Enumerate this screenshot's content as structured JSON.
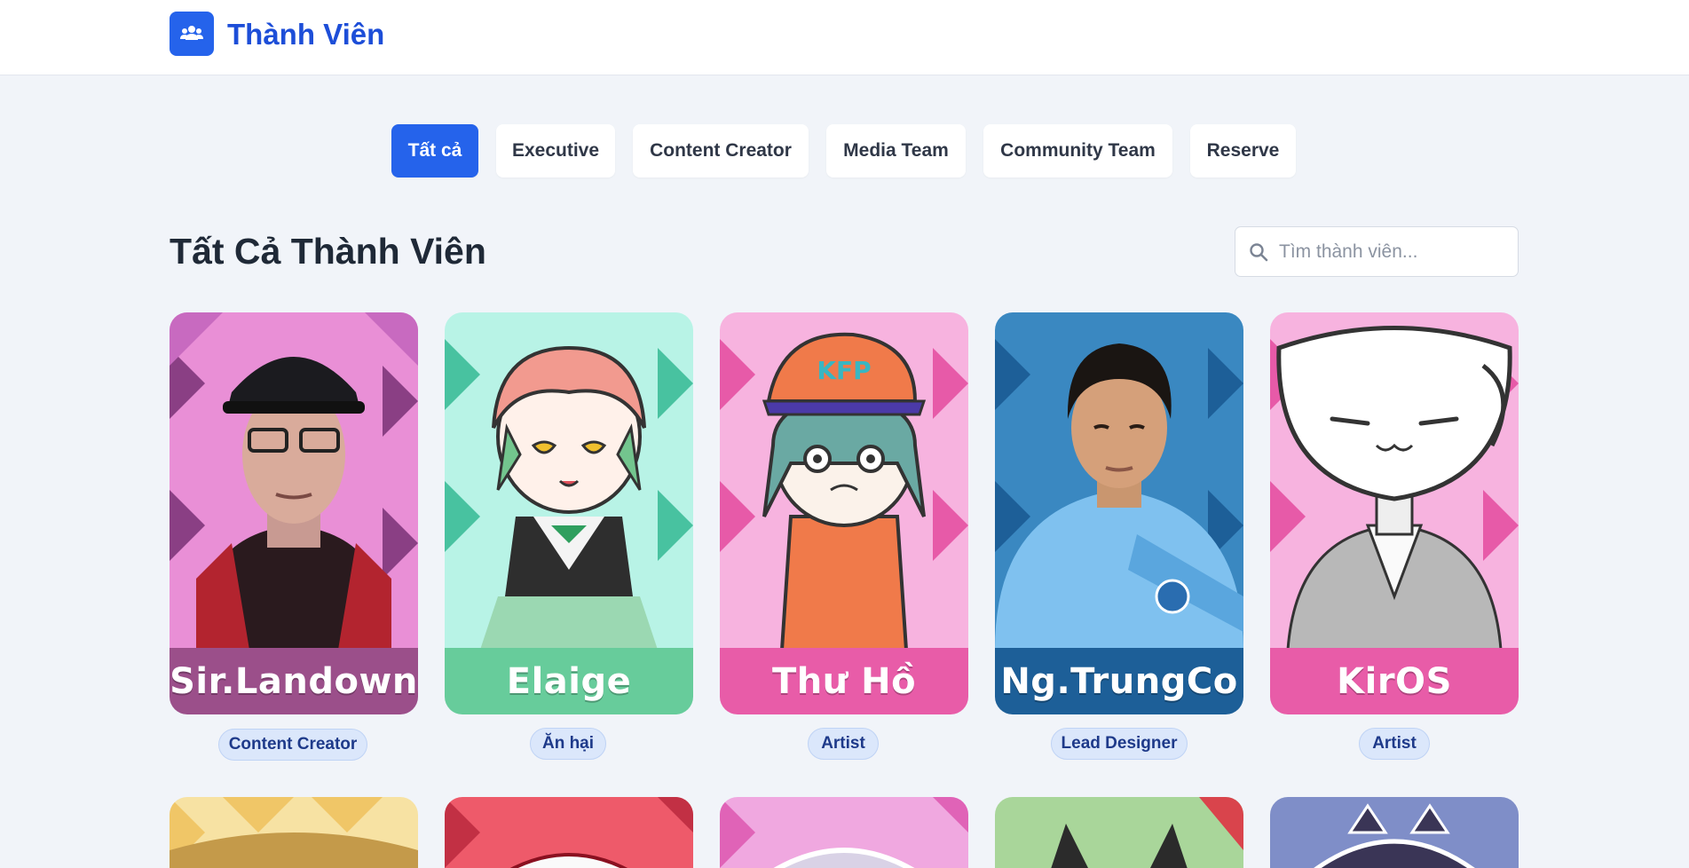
{
  "header": {
    "site_title": "Thành Viên",
    "logo_icon": "users-icon"
  },
  "tabs": [
    {
      "label": "Tất cả",
      "active": true
    },
    {
      "label": "Executive",
      "active": false
    },
    {
      "label": "Content Creator",
      "active": false
    },
    {
      "label": "Media Team",
      "active": false
    },
    {
      "label": "Community Team",
      "active": false
    },
    {
      "label": "Reserve",
      "active": false
    }
  ],
  "section": {
    "title": "Tất Cả Thành Viên",
    "search_placeholder": "Tìm thành viên...",
    "search_value": ""
  },
  "members": [
    {
      "name": "Sir.Landown",
      "role": "Content Creator",
      "band_color": "#9b4f8a",
      "bg_color": "#e98fd6"
    },
    {
      "name": "Elaige",
      "role": "Ăn hại",
      "band_color": "#67cc9b",
      "bg_color": "#b8f3e6"
    },
    {
      "name": "Thư Hồ",
      "role": "Artist",
      "band_color": "#e85ca8",
      "bg_color": "#f7b3df"
    },
    {
      "name": "Ng.TrungCo",
      "role": "Lead Designer",
      "band_color": "#1d5f98",
      "bg_color": "#3a88c1"
    },
    {
      "name": "KirOS",
      "role": "Artist",
      "band_color": "#e85ca8",
      "bg_color": "#f7b3df"
    }
  ],
  "members_row2": [
    {
      "bg_color": "#f7e2a3"
    },
    {
      "bg_color": "#ee5a6a"
    },
    {
      "bg_color": "#f0a8e0"
    },
    {
      "bg_color": "#a9d69a"
    },
    {
      "bg_color": "#7f8ec8"
    }
  ]
}
